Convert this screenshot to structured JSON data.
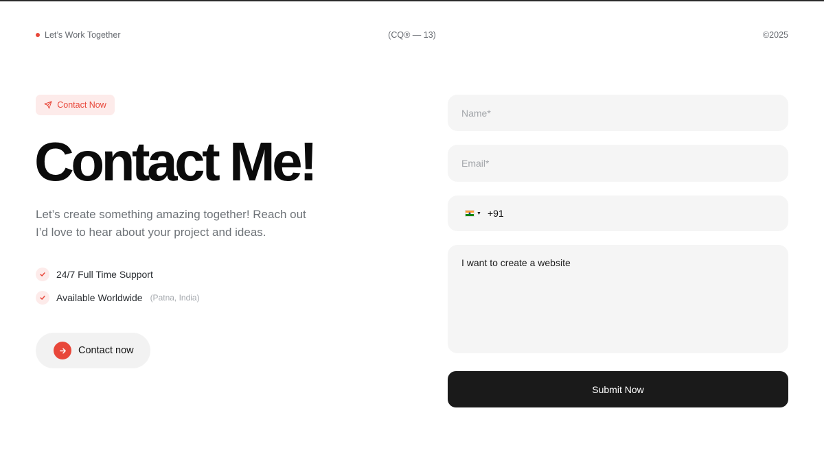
{
  "header": {
    "tagline": "Let’s Work Together",
    "center_text": "(CQ® — 13)",
    "copyright": "©2025"
  },
  "hero": {
    "badge_label": "Contact Now",
    "title": "Contact Me!",
    "subtitle": "Let’s create something amazing together! Reach out I’d love to hear about your project and ideas.",
    "features": [
      {
        "label": "24/7 Full Time Support",
        "note": ""
      },
      {
        "label": "Available Worldwide",
        "note": "(Patna, India)"
      }
    ],
    "cta_label": "Contact now"
  },
  "form": {
    "name_placeholder": "Name*",
    "email_placeholder": "Email*",
    "phone": {
      "country_flag": "india-flag-icon",
      "dial_code": "+91"
    },
    "message_value": "I want to create a website",
    "submit_label": "Submit Now"
  },
  "colors": {
    "accent": "#e8473a",
    "accent_soft": "#fdebea",
    "field_bg": "#f5f5f5",
    "button_dark": "#1a1a1a"
  }
}
